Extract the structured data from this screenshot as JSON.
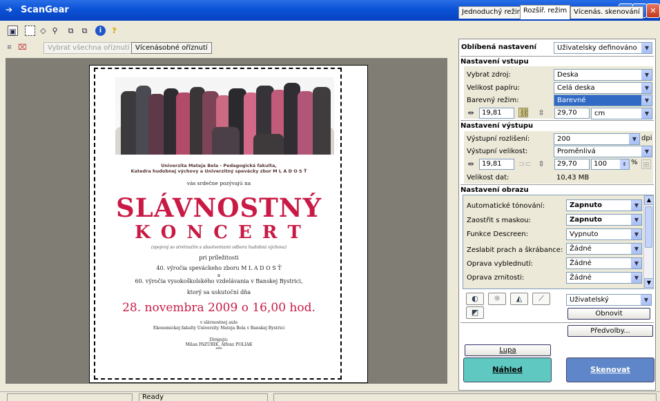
{
  "window": {
    "title": "ScanGear"
  },
  "toolbar": {
    "icons": [
      "thumbnail-icon",
      "select-frame-icon",
      "eraser-icon",
      "zoom-icon",
      "select-all-icon",
      "copy-icon",
      "info-icon",
      "help-icon"
    ],
    "info_glyph": "i",
    "help_glyph": "?"
  },
  "cropbar": {
    "select_all_label": "Vybrat všechna oříznutí",
    "multi_crop_label": "Vícenásobné oříznutí"
  },
  "tabs": [
    "Jednoduchý režim",
    "Rozšíř. režim",
    "Vícenás. skenování"
  ],
  "active_tab": 1,
  "favorites": {
    "label": "Oblíbená nastavení",
    "value": "Uživatelsky definováno"
  },
  "input_settings": {
    "heading": "Nastavení vstupu",
    "source_label": "Vybrat zdroj:",
    "source_value": "Deska",
    "paper_label": "Velikost papíru:",
    "paper_value": "Celá deska",
    "color_label": "Barevný režim:",
    "color_value": "Barevné",
    "width": "19,81",
    "height": "29,70",
    "unit": "cm"
  },
  "output_settings": {
    "heading": "Nastavení výstupu",
    "resolution_label": "Výstupní rozlišení:",
    "resolution_value": "200",
    "resolution_unit": "dpi",
    "size_label": "Výstupní velikost:",
    "size_value": "Proměnlivá",
    "width": "19,81",
    "height": "29,70",
    "scale": "100",
    "scale_unit": "%",
    "data_size_label": "Velikost dat:",
    "data_size_value": "10,43 MB"
  },
  "image_settings": {
    "heading": "Nastavení obrazu",
    "rows": [
      {
        "label": "Automatické tónování:",
        "value": "Zapnuto",
        "bold": true
      },
      {
        "label": "Zaostřit s maskou:",
        "value": "Zapnuto",
        "bold": true
      },
      {
        "label": "Funkce Descreen:",
        "value": "Vypnuto",
        "bold": false
      },
      {
        "label": "Zeslabit prach a škrábance:",
        "value": "Žádné",
        "bold": false
      },
      {
        "label": "Oprava vyblednutí:",
        "value": "Žádné",
        "bold": false
      },
      {
        "label": "Oprava zrnitosti:",
        "value": "Žádné",
        "bold": false
      }
    ]
  },
  "color_tools": {
    "preset_value": "Uživatelský",
    "reset_label": "Obnovit"
  },
  "preferences_label": "Předvolby...",
  "zoom_label": "Lupa",
  "preview_label": "Náhled",
  "scan_label": "Skenovat",
  "status": {
    "text": "Ready"
  },
  "poster": {
    "university_line1": "Univerzita Mateja Bela - Pedagogická fakulta,",
    "university_line2": "Katedra hudobnej výchovy a Univerzitný spevácky zbor  M L A D O S Ť",
    "invite": "vás srdečne pozývajú na",
    "title1": "SLÁVNOSTNÝ",
    "title2": "K O N C E R T",
    "subtitle": "(spojený so stretnutím s absolventami odboru hudobná výchova)",
    "occasion": "pri príležitosti",
    "line_a": "40. výročia speváckeho zboru M L A D O S Ť",
    "line_and": "a",
    "line_b": "60. výročia vysokoškolského vzdelávania v Banskej Bystrici,",
    "line_c": "ktorý sa uskutoční dňa",
    "date": "28. novembra 2009 o 16,00 hod.",
    "venue1": "v slávnostnej aule",
    "venue2": "Ekonomickej fakulty Univerzity Mateja Bela v Banskej Bystrici",
    "conductors_label": "Dirigujú:",
    "conductors": "Milan PAZÚRIK, Alfonz POLIAK",
    "stars": "***"
  },
  "colors": {
    "titlebar": "#0a52d6",
    "preview_button": "#5fc8c0",
    "scan_button": "#5f86c8",
    "poster_red": "#c81a45"
  }
}
